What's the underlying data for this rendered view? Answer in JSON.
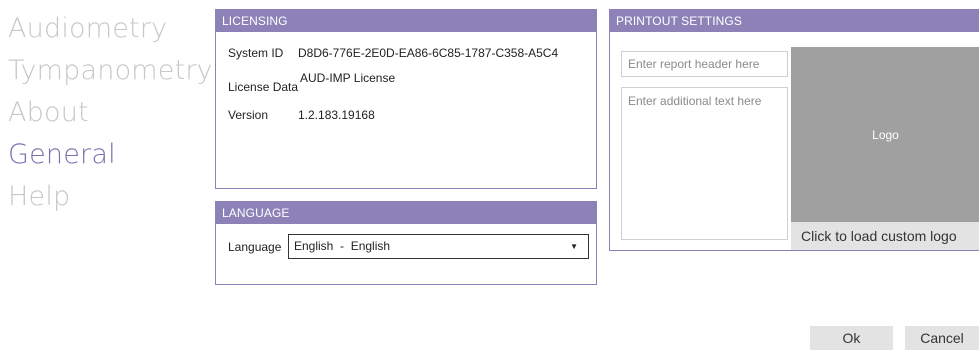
{
  "nav": {
    "items": [
      {
        "label": "Audiometry"
      },
      {
        "label": "Tympanometry"
      },
      {
        "label": "About"
      },
      {
        "label": "General"
      },
      {
        "label": "Help"
      }
    ],
    "active": "General"
  },
  "licensing": {
    "title": "LICENSING",
    "system_id_label": "System ID",
    "system_id": "D8D6-776E-2E0D-EA86-6C85-1787-C358-A5C4",
    "license_data_label": "License Data",
    "license_data": "AUD-IMP License",
    "version_label": "Version",
    "version": "1.2.183.19168"
  },
  "language": {
    "title": "LANGUAGE",
    "label": "Language",
    "selected": "English  -  English",
    "arrow_icon": "triangle-down"
  },
  "printout": {
    "title": "PRINTOUT SETTINGS",
    "header_placeholder": "Enter report header here",
    "text_placeholder": "Enter additional text here",
    "logo_label": "Logo",
    "load_logo_label": "Click to load custom logo"
  },
  "footer": {
    "ok_label": "Ok",
    "cancel_label": "Cancel"
  },
  "colors": {
    "accent": "#8c82b8",
    "nav_active": "#7b6fae",
    "nav_inactive": "#c7c7c7",
    "logo_bg": "#a0a0a0"
  }
}
